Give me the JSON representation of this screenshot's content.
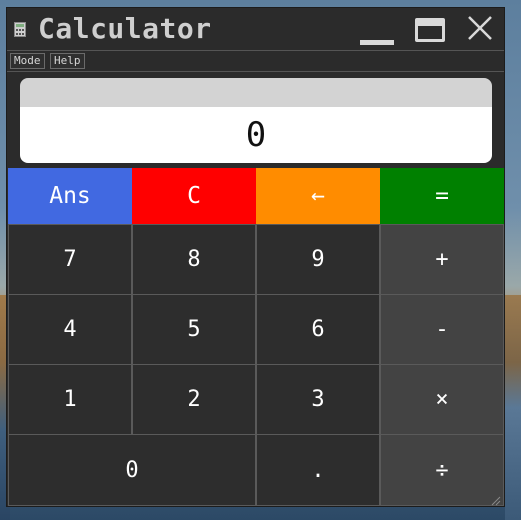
{
  "window": {
    "title": "Calculator",
    "icon": "calculator-icon",
    "controls": [
      "minimize-icon",
      "maximize-icon",
      "close-icon"
    ],
    "close_glyph": "✕"
  },
  "menu": {
    "mode": "Mode",
    "help": "Help"
  },
  "display": {
    "value": "0"
  },
  "keys": {
    "ans": "Ans",
    "clear": "C",
    "backspace": "←",
    "equals": "=",
    "seven": "7",
    "eight": "8",
    "nine": "9",
    "plus": "+",
    "four": "4",
    "five": "5",
    "six": "6",
    "minus": "-",
    "one": "1",
    "two": "2",
    "three": "3",
    "multiply": "×",
    "zero": "0",
    "decimal": ".",
    "divide": "÷"
  },
  "colors": {
    "ans": "#4169e1",
    "clear": "#ff0000",
    "backspace": "#ff8c00",
    "equals": "#008000",
    "digit_key": "#2d2d2d",
    "operator_key": "#434343",
    "window_bg": "#2b2b2b"
  }
}
